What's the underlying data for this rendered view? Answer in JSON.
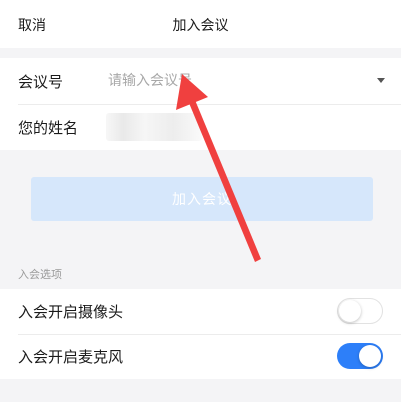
{
  "header": {
    "cancel_label": "取消",
    "title": "加入会议"
  },
  "form": {
    "meeting_label": "会议号",
    "meeting_placeholder": "请输入会议号",
    "meeting_value": "",
    "name_label": "您的姓名",
    "name_value": ""
  },
  "join_button": {
    "label": "加入会议"
  },
  "options": {
    "section_title": "入会选项",
    "items": [
      {
        "label": "入会开启摄像头",
        "enabled": false
      },
      {
        "label": "入会开启麦克风",
        "enabled": true
      }
    ]
  },
  "colors": {
    "accent": "#2d7ff9",
    "button_disabled": "#d6e7fb",
    "annotation_arrow": "#f0403f"
  },
  "icons": {
    "dropdown": "chevron-down-icon",
    "annotation": "red-arrow-annotation"
  }
}
